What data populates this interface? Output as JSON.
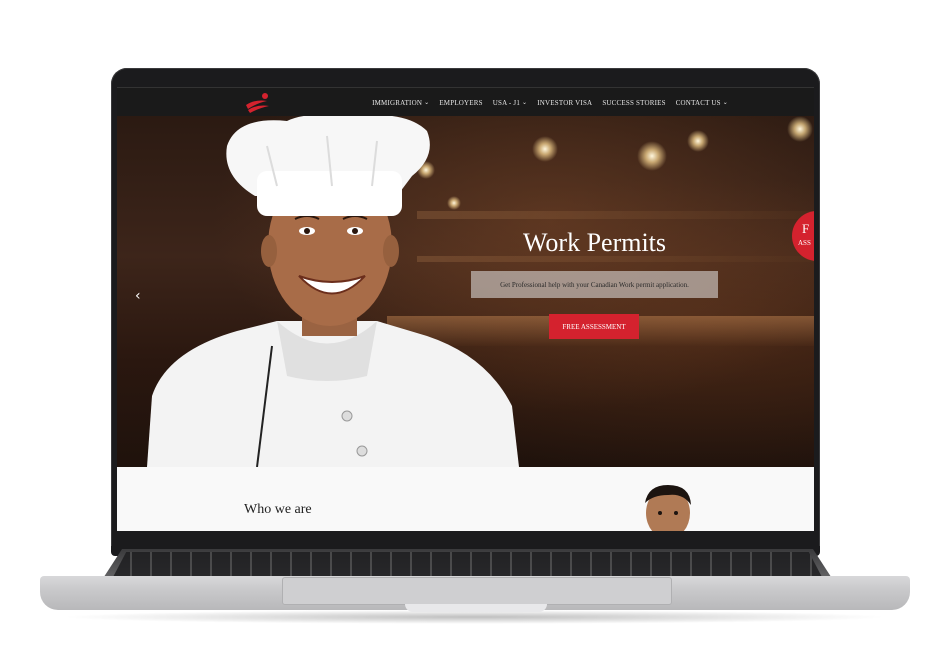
{
  "nav": {
    "items": [
      {
        "label": "IMMIGRATION",
        "has_dropdown": true
      },
      {
        "label": "EMPLOYERS",
        "has_dropdown": false
      },
      {
        "label": "USA - J1",
        "has_dropdown": true
      },
      {
        "label": "INVESTOR VISA",
        "has_dropdown": false
      },
      {
        "label": "SUCCESS STORIES",
        "has_dropdown": false
      },
      {
        "label": "CONTACT US",
        "has_dropdown": true
      }
    ],
    "logo_icon": "maple-swirl-logo"
  },
  "hero": {
    "title": "Work Permits",
    "subtitle": "Get Professional help with your Canadian Work permit application.",
    "cta_label": "FREE ASSESSMENT",
    "prev_glyph": "‹",
    "badge_big": "F",
    "badge_small": "ASS"
  },
  "section": {
    "heading": "Who we are"
  },
  "colors": {
    "accent": "#d4222e",
    "navbar": "#1a1a1a"
  }
}
